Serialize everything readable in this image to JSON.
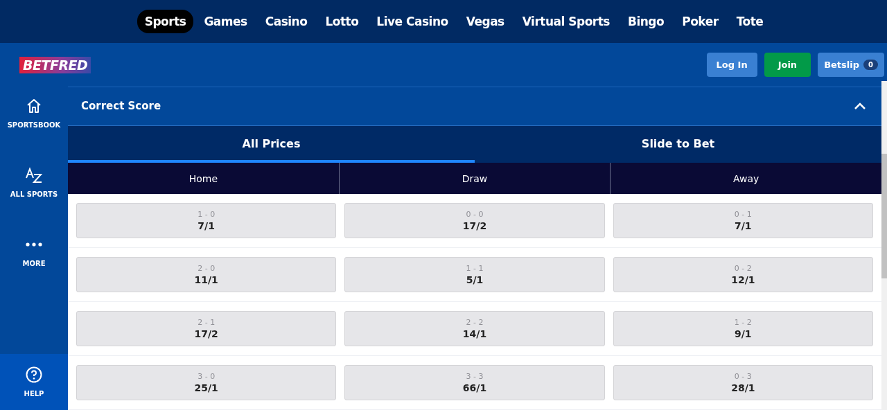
{
  "top_nav": [
    {
      "label": "Sports",
      "selected": true
    },
    {
      "label": "Games",
      "selected": false
    },
    {
      "label": "Casino",
      "selected": false
    },
    {
      "label": "Lotto",
      "selected": false
    },
    {
      "label": "Live Casino",
      "selected": false
    },
    {
      "label": "Vegas",
      "selected": false
    },
    {
      "label": "Virtual Sports",
      "selected": false
    },
    {
      "label": "Bingo",
      "selected": false
    },
    {
      "label": "Poker",
      "selected": false
    },
    {
      "label": "Tote",
      "selected": false
    }
  ],
  "header": {
    "logo": "BETFRED",
    "login": "Log In",
    "join": "Join",
    "betslip": "Betslip",
    "betslip_count": "0"
  },
  "sidebar": {
    "items": [
      {
        "kind": "home",
        "label": "SPORTSBOOK"
      },
      {
        "kind": "az",
        "label": "ALL SPORTS"
      },
      {
        "kind": "more",
        "label": "MORE"
      }
    ],
    "help": {
      "label": "HELP"
    }
  },
  "market": {
    "title": "Correct Score",
    "expanded": true,
    "tabs": [
      {
        "label": "All Prices",
        "selected": true
      },
      {
        "label": "Slide to Bet",
        "selected": false
      }
    ],
    "columns": [
      "Home",
      "Draw",
      "Away"
    ],
    "rows": [
      [
        {
          "score": "1 - 0",
          "odds": "7/1"
        },
        {
          "score": "0 - 0",
          "odds": "17/2"
        },
        {
          "score": "0 - 1",
          "odds": "7/1"
        }
      ],
      [
        {
          "score": "2 - 0",
          "odds": "11/1"
        },
        {
          "score": "1 - 1",
          "odds": "5/1"
        },
        {
          "score": "0 - 2",
          "odds": "12/1"
        }
      ],
      [
        {
          "score": "2 - 1",
          "odds": "17/2"
        },
        {
          "score": "2 - 2",
          "odds": "14/1"
        },
        {
          "score": "1 - 2",
          "odds": "9/1"
        }
      ],
      [
        {
          "score": "3 - 0",
          "odds": "25/1"
        },
        {
          "score": "3 - 3",
          "odds": "66/1"
        },
        {
          "score": "0 - 3",
          "odds": "28/1"
        }
      ]
    ]
  }
}
